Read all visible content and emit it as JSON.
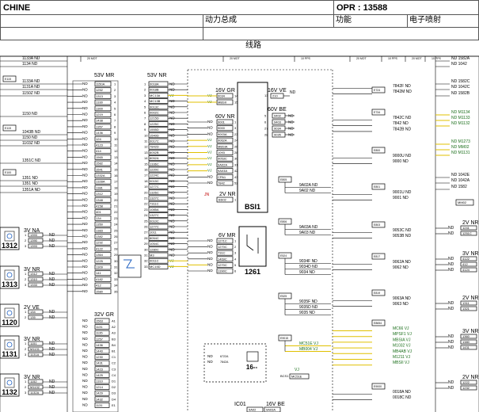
{
  "header": {
    "title_left": "CHINE",
    "opr": "OPR : 13588",
    "group": "动力总成",
    "function_label": "功能",
    "function_value": "电子喷射",
    "section": "线路"
  },
  "ruler": {
    "marks": [
      "20 MOT",
      "20 MOT",
      "10 PPS",
      "20 MOT",
      "10 PPS",
      "20 MOT",
      "10 PPS"
    ]
  },
  "left_edge_wires": {
    "top": [
      "1133A ND",
      "1134 ND",
      "1133A ND",
      "1131A ND",
      "1150Z ND",
      "1150 ND",
      "1043B ND",
      "1150 ND",
      "1103Z ND",
      "1351C ND",
      "1351 ND",
      "1351 ND",
      "1351A ND"
    ],
    "boxes": [
      "E115",
      "E115",
      "E100"
    ]
  },
  "left_components": [
    {
      "id": "1312",
      "conn": "3V NA",
      "pins": [
        "1",
        "2",
        "3"
      ],
      "wires": [
        "1393",
        "1390",
        "1393"
      ],
      "colors": [
        "ND",
        "ND",
        "ND"
      ]
    },
    {
      "id": "1313",
      "conn": "3V NR",
      "pins": [
        "1",
        "2",
        "3"
      ],
      "wires": [
        "1312",
        "1310",
        "1333"
      ],
      "colors": [
        "ND",
        "ND",
        "ND"
      ]
    },
    {
      "id": "1120",
      "conn": "2V VE",
      "pins": [
        "1",
        "2"
      ],
      "wires": [
        "134",
        "135"
      ],
      "colors": [
        "ND",
        "ND"
      ]
    },
    {
      "id": "1131",
      "conn": "3V NR",
      "pins": [
        "1",
        "2",
        "3"
      ],
      "wires": [
        "1151",
        "M1131",
        "1131A"
      ],
      "colors": [
        "ND",
        "ND",
        "ND"
      ]
    },
    {
      "id": "1132",
      "conn": "3V NR",
      "pins": [
        "1",
        "2",
        "3"
      ],
      "wires": [
        "1152",
        "M1132",
        "1132A"
      ],
      "colors": [
        "ND",
        "ND",
        "ND"
      ]
    }
  ],
  "connector_53v_mr": {
    "title": "53V MR",
    "wires": [
      "1150A",
      "1252",
      "1313",
      "1330",
      "1300",
      "1219",
      "1438",
      "1357",
      "1436",
      "124",
      "4123",
      "414",
      "1565",
      "1582",
      "1541",
      "1332A",
      "1328A",
      "1381",
      "1312",
      "1348",
      "4158",
      "401",
      "134",
      "1350",
      "1383",
      "1382",
      "1292",
      "4122",
      "1364",
      "1225",
      "1309",
      "141",
      "4182",
      "412",
      "1580"
    ],
    "colors": [
      "ND",
      "ND",
      "ND",
      "ND",
      "ND",
      "ND",
      "ND",
      "ND",
      "ND",
      "ND",
      "ND",
      "ND",
      "ND",
      "ND",
      "ND",
      "ND",
      "ND",
      "ND",
      "ND",
      "ND",
      "ND",
      "ND",
      "ND",
      "ND",
      "ND",
      "ND",
      "ND",
      "ND",
      "ND",
      "ND",
      "ND",
      "ND",
      "ND",
      "ND",
      "ND"
    ]
  },
  "connector_53v_nr": {
    "title": "53V NR",
    "wires": [
      "0018A",
      "0018B",
      "MC13A",
      "MC13B",
      "0013C",
      "0002C",
      "1215D",
      "1225C",
      "1555D",
      "1540D",
      "0017C",
      "7842D",
      "8052B",
      "8052A",
      "1336C",
      "1220C",
      "1224C",
      "0015C",
      "1277C",
      "1326C",
      "1327C",
      "7311C",
      "1085A",
      "1327C",
      "0010C",
      "1277C",
      "1011",
      "8054C",
      "1054C",
      "1280C",
      "M3",
      "0011C",
      "MC15D"
    ],
    "colors": [
      "ND",
      "ND",
      "VJ",
      "ND",
      "ND",
      "ND",
      "ND",
      "ND",
      "ND",
      "ND",
      "ND",
      "ND",
      "ND",
      "ND",
      "ND",
      "ND",
      "ND",
      "ND",
      "ND",
      "ND",
      "ND",
      "ND",
      "ND",
      "ND",
      "ND",
      "ND",
      "ND",
      "ND",
      "ND",
      "ND",
      "ND",
      "VJ",
      "VJ"
    ]
  },
  "connector_32v_gr": {
    "title": "32V GR",
    "wires": [
      "1563",
      "1131",
      "1135",
      "1257",
      "1436",
      "1440",
      "1230",
      "1431",
      "1423",
      "1425",
      "1310",
      "1214",
      "1429",
      "1432",
      "1131"
    ],
    "pins": [
      "A1",
      "A2",
      "A3",
      "B3",
      "B4",
      "B1",
      "C1",
      "C2",
      "C3",
      "C4",
      "D1",
      "D2",
      "D3",
      "D4",
      "E1"
    ]
  },
  "bsi": {
    "label": "BSI1",
    "conn_16v_gr": {
      "title": "16V GR",
      "wires": [
        "0034",
        "MBSII"
      ],
      "pins": [
        "14",
        "15"
      ],
      "colors": [
        "VJ",
        "VJ"
      ]
    },
    "conn_16v_ve": {
      "title": "16V VE",
      "wires": [
        "210"
      ],
      "pins": [
        "13"
      ],
      "colors": [
        "ND"
      ]
    },
    "conn_60v_nr": {
      "title": "60V NR",
      "wires": [
        "9001",
        "9000",
        "9003A",
        "9062A",
        "MBSIA",
        "1093",
        "9053C",
        "9A02A",
        "9A03A",
        "CPA1",
        "7842"
      ],
      "pins": [
        "1",
        "3",
        "23",
        "24",
        "26",
        "28",
        "30",
        "31",
        "42",
        "43",
        "52"
      ],
      "colors": [
        "ND",
        "ND",
        "ND",
        "VJ",
        "VJ",
        "VJ",
        "VJ",
        "VJ",
        "VJ",
        "ND",
        "ND"
      ]
    },
    "conn_60v_be": {
      "title": "60V BE",
      "wires": [
        "9402",
        "9403",
        "9034",
        "9035"
      ],
      "pins": [
        "5",
        "6",
        "27",
        "28"
      ],
      "colors": [
        "ND",
        "ND",
        "ND",
        "ND"
      ]
    },
    "conn_2v_nr": {
      "title": "2V NR",
      "wire": "BS02",
      "pins": [
        "1",
        "2"
      ],
      "marker": "JN"
    }
  },
  "relay_1261": {
    "label": "1261",
    "conn": "6V MR",
    "wires": [
      "1271C",
      "1270C",
      "731C",
      "1469C",
      "1270C",
      "1390C"
    ],
    "pins": [
      "1",
      "2",
      "3",
      "4",
      "5",
      "6"
    ],
    "colors": [
      "ND",
      "ND",
      "ND",
      "ND",
      "ND",
      "ND"
    ]
  },
  "component_16": {
    "label": "16--",
    "wires": [
      "6722A",
      "7842A"
    ],
    "colors": [
      "ND",
      "ND"
    ]
  },
  "center_splices": [
    {
      "id": "E805",
      "wires": [
        "9A02A ND",
        "9A02 ND"
      ]
    },
    {
      "id": "E806",
      "wires": [
        "9A03A ND",
        "9A03 ND"
      ]
    },
    {
      "id": "E524",
      "wires": [
        "9034F ND",
        "9034D ND",
        "9034 ND"
      ]
    },
    {
      "id": "E525",
      "wires": [
        "9035F ND",
        "9035D ND",
        "9035 ND"
      ]
    },
    {
      "id": "E9015",
      "wires": [
        "MC51E VJ",
        "MB004 VJ"
      ]
    }
  ],
  "bottom_labels": {
    "bcs": "BCS1",
    "wire": "MC51E",
    "marker": "VJ",
    "ic01": "IC01",
    "conn_16v_be": "16V BE",
    "wires": [
      "9A02",
      "9A03A"
    ]
  },
  "right_wires": [
    {
      "id": "E724",
      "wires": [
        "7842F ND",
        "7842M ND"
      ]
    },
    {
      "id": "E734",
      "wires": [
        "7842C ND",
        "7842 ND",
        "7842B ND"
      ]
    },
    {
      "id": "E800",
      "wires": [
        "9000U ND",
        "9000 ND"
      ]
    },
    {
      "id": "E801",
      "wires": [
        "9001U ND",
        "9001 ND"
      ]
    },
    {
      "id": "E803",
      "wires": [
        "9053C ND",
        "9053B ND"
      ]
    },
    {
      "id": "E817",
      "wires": [
        "9062A ND",
        "9062 ND"
      ]
    },
    {
      "id": "E819",
      "wires": [
        "9063A ND",
        "9063 ND"
      ]
    },
    {
      "id": "E8654",
      "wires": [
        "MC66 VJ",
        "MPSF1 VJ",
        "MBSIA VJ",
        "M1032 VJ",
        "MB4AB VJ",
        "M1211 VJ",
        "MBSII VJ"
      ]
    },
    {
      "id": "E9000",
      "wires": [
        "0018A ND",
        "0018C ND"
      ]
    }
  ],
  "right_edge": {
    "top": [
      "ND 1582A",
      "ND 1042",
      "ND 1582C",
      "ND 1042C",
      "ND 1582B"
    ],
    "green": [
      "ND M1134",
      "ND M1133",
      "ND M1132",
      "ND M1273",
      "ND MM02",
      "ND M1131"
    ],
    "mid": [
      "ND 1042E",
      "ND 1042A",
      "ND 1582"
    ],
    "box": "MM02",
    "comps": [
      {
        "conn": "2V NR",
        "wires": [
          "1241",
          "1251C"
        ]
      },
      {
        "conn": "3V NR",
        "wires": [
          "4122",
          "412",
          "4124"
        ]
      },
      {
        "conn": "2V NR",
        "wires": [
          "1311",
          "1321"
        ]
      },
      {
        "conn": "3V NR",
        "wires": [
          "1360",
          "1380",
          "1431"
        ]
      },
      {
        "conn": "2V NR",
        "wires": [
          "1222",
          "1232"
        ]
      }
    ]
  }
}
